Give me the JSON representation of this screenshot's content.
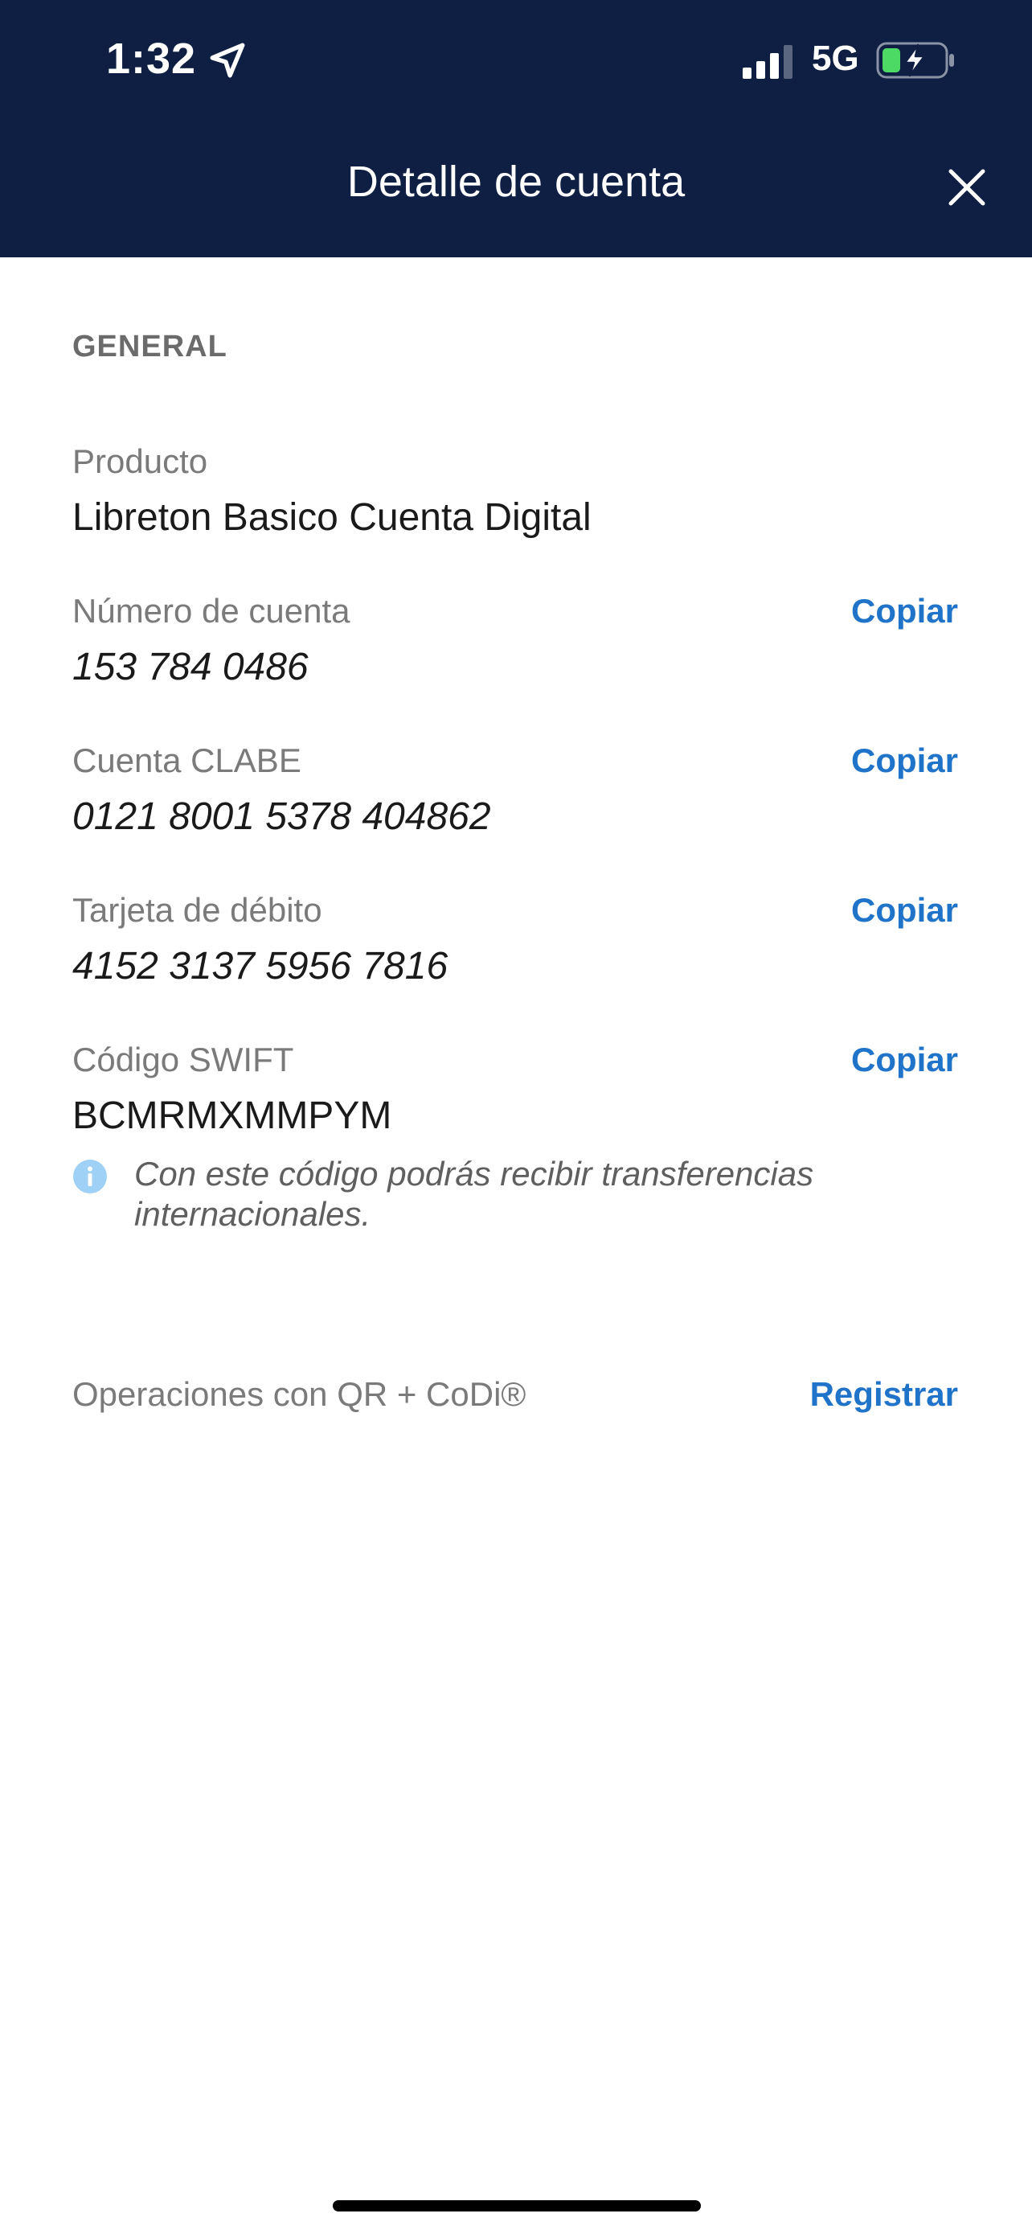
{
  "status_bar": {
    "time": "1:32",
    "network": "5G"
  },
  "header": {
    "title": "Detalle de cuenta"
  },
  "section": {
    "title": "GENERAL"
  },
  "fields": {
    "product": {
      "label": "Producto",
      "value": "Libreton Basico Cuenta Digital"
    },
    "account_number": {
      "label": "Número de cuenta",
      "value": "153 784 0486",
      "action": "Copiar"
    },
    "clabe": {
      "label": "Cuenta CLABE",
      "value": "0121 8001 5378 404862",
      "action": "Copiar"
    },
    "debit_card": {
      "label": "Tarjeta de débito",
      "value": "4152 3137 5956 7816",
      "action": "Copiar"
    },
    "swift": {
      "label": "Código SWIFT",
      "value": "BCMRMXMMPYM",
      "action": "Copiar",
      "info": "Con este código podrás recibir transferencias internacionales."
    }
  },
  "qr_codi": {
    "label": "Operaciones con QR + CoDi®",
    "action": "Registrar"
  },
  "colors": {
    "header_bg": "#0f1f43",
    "link": "#1f73c9",
    "info_icon": "#9fd0f5",
    "battery_charge": "#4cd964"
  }
}
